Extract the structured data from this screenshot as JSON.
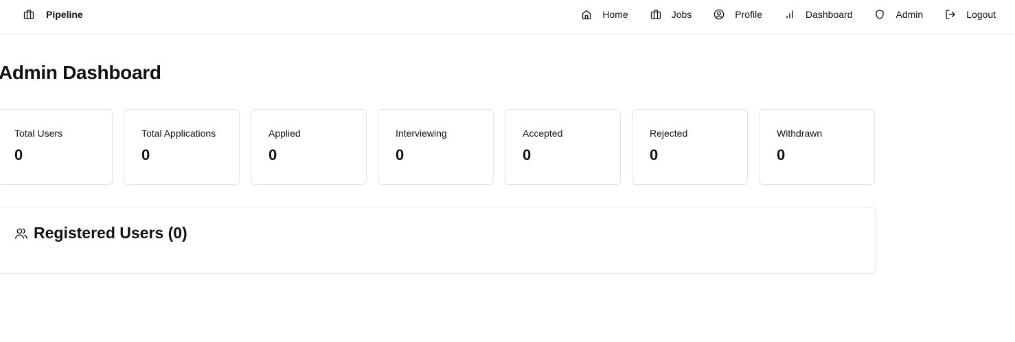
{
  "app": {
    "brand": "Pipeline"
  },
  "nav": {
    "items": [
      {
        "label": "Home",
        "icon": "home-icon"
      },
      {
        "label": "Jobs",
        "icon": "briefcase-icon"
      },
      {
        "label": "Profile",
        "icon": "user-circle-icon"
      },
      {
        "label": "Dashboard",
        "icon": "bar-chart-icon"
      },
      {
        "label": "Admin",
        "icon": "shield-icon"
      },
      {
        "label": "Logout",
        "icon": "logout-icon"
      }
    ]
  },
  "page": {
    "title": "Admin Dashboard"
  },
  "stats": [
    {
      "label": "Total Users",
      "value": "0"
    },
    {
      "label": "Total Applications",
      "value": "0"
    },
    {
      "label": "Applied",
      "value": "0"
    },
    {
      "label": "Interviewing",
      "value": "0"
    },
    {
      "label": "Accepted",
      "value": "0"
    },
    {
      "label": "Rejected",
      "value": "0"
    },
    {
      "label": "Withdrawn",
      "value": "0"
    }
  ],
  "users_panel": {
    "title": "Registered Users (0)",
    "icon": "users-icon"
  }
}
